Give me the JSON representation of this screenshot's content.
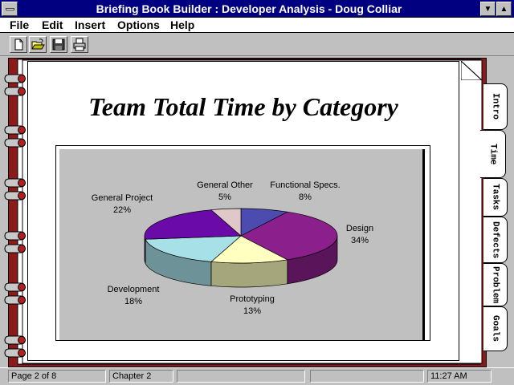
{
  "window": {
    "title": "Briefing Book Builder : Developer Analysis - Doug Colliar"
  },
  "menu": {
    "items": [
      "File",
      "Edit",
      "Insert",
      "Options",
      "Help"
    ]
  },
  "toolbar": {
    "buttons": [
      "new-icon",
      "open-icon",
      "save-icon",
      "print-icon"
    ]
  },
  "page": {
    "title": "Team Total Time by Category"
  },
  "tabs": [
    "Intro",
    "Time",
    "Tasks",
    "Defects",
    "Problem",
    "Goals"
  ],
  "active_tab": "Time",
  "status": {
    "page": "Page 2 of 8",
    "chapter": "Chapter 2",
    "time": "11:27 AM"
  },
  "chart_data": {
    "type": "pie",
    "title": "",
    "slices": [
      {
        "label": "Functional Specs.",
        "percent_label": "8%",
        "value": 8,
        "color": "#4b4bb0"
      },
      {
        "label": "Design",
        "percent_label": "34%",
        "value": 34,
        "color": "#8b1f8b"
      },
      {
        "label": "Prototyping",
        "percent_label": "13%",
        "value": 13,
        "color": "#ffffc0"
      },
      {
        "label": "Development",
        "percent_label": "18%",
        "value": 18,
        "color": "#a8e0e8"
      },
      {
        "label": "General Project",
        "percent_label": "22%",
        "value": 22,
        "color": "#6a0aa8"
      },
      {
        "label": "General Other",
        "percent_label": "5%",
        "value": 5,
        "color": "#e0c8c8"
      }
    ]
  },
  "colors": {
    "titlebar": "#000080",
    "book_cover": "#8b1a1a",
    "chart_background": "#c0c0c0"
  }
}
